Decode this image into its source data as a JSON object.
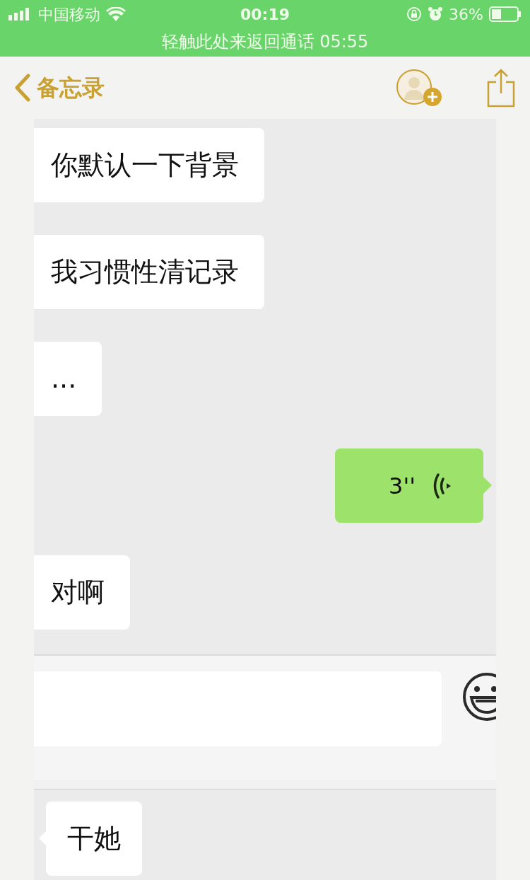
{
  "status_bar": {
    "carrier": "中国移动",
    "time": "00:19",
    "battery": "36%"
  },
  "call_banner": "轻触此处来返回通话 05:55",
  "nav": {
    "back_label": "备忘录"
  },
  "chat_top": {
    "messages": [
      {
        "kind": "text",
        "outgoing": false,
        "text": "你默认一下背景"
      },
      {
        "kind": "text",
        "outgoing": false,
        "text": "我习惯性清记录"
      },
      {
        "kind": "text",
        "outgoing": false,
        "text": "..."
      },
      {
        "kind": "voice",
        "outgoing": true,
        "duration": "3''"
      },
      {
        "kind": "text",
        "outgoing": false,
        "text": "对啊"
      }
    ]
  },
  "chat_bottom": {
    "messages": [
      {
        "kind": "text",
        "outgoing": false,
        "text": "干她"
      }
    ]
  }
}
